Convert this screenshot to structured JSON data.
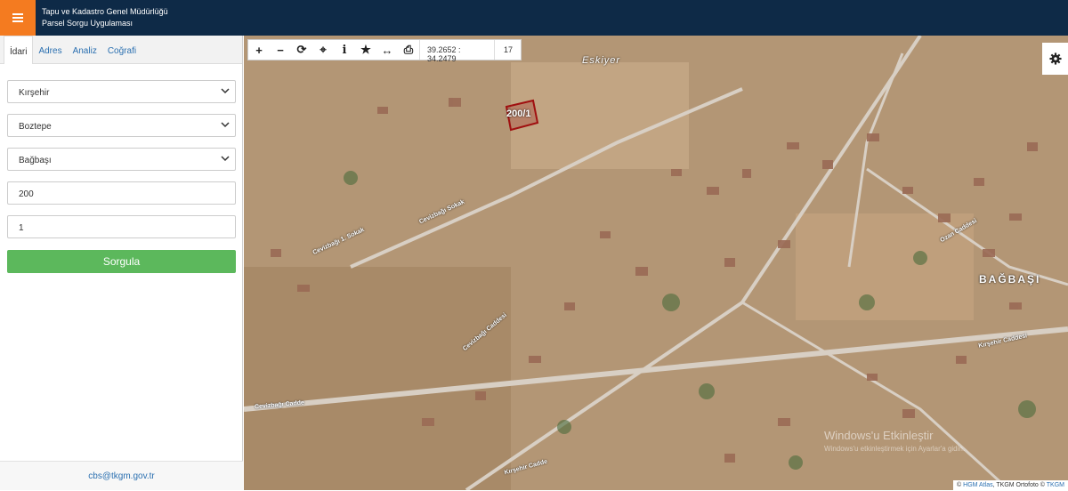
{
  "header": {
    "title_line1": "Tapu ve Kadastro Genel Müdürlüğü",
    "title_line2": "Parsel Sorgu Uygulaması",
    "menu_icon": "hamburger-icon"
  },
  "sidebar": {
    "tabs": [
      "İdari",
      "Adres",
      "Analiz",
      "Coğrafi"
    ],
    "active_tab": "İdari",
    "province": "Kırşehir",
    "district": "Boztepe",
    "neighborhood": "Bağbaşı",
    "block": "200",
    "parcel": "1",
    "submit_label": "Sorgula",
    "footer_email": "cbs@tkgm.gov.tr"
  },
  "toolbar": {
    "coords": "39.2652 : 34.2479",
    "zoom": "17",
    "icons": [
      "zoom-in-icon",
      "zoom-out-icon",
      "refresh-icon",
      "locate-icon",
      "info-icon",
      "star-icon",
      "measure-icon",
      "print-icon"
    ]
  },
  "map": {
    "parcel_label": "200/1",
    "places": {
      "eskiyer": "Eskiyer",
      "bagbasi": "BAĞBAŞI"
    },
    "streets": {
      "cevizbagi_sokak": "Cevizbağı Sokak",
      "cevizbagi_1_sokak": "Cevizbağı 1. Sokak",
      "cevizbagi_caddesi": "Cevizbağı Caddesi",
      "cevizbagi_cadde": "Cevizbağı Cadde",
      "ozan_caddesi": "Ozan Caddesi",
      "kirsehir_caddesi": "Kırşehir Caddesi",
      "kirsehir_cadde": "Kırşehir Cadde"
    },
    "attribution": {
      "hgm": "HGM Atlas",
      "ortofoto": "TKGM Ortofoto",
      "tkgm": "TKGM"
    },
    "watermark_title": "Windows'u Etkinleştir",
    "watermark_sub": "Windows'u etkinleştirmek için Ayarlar'a gidin."
  }
}
